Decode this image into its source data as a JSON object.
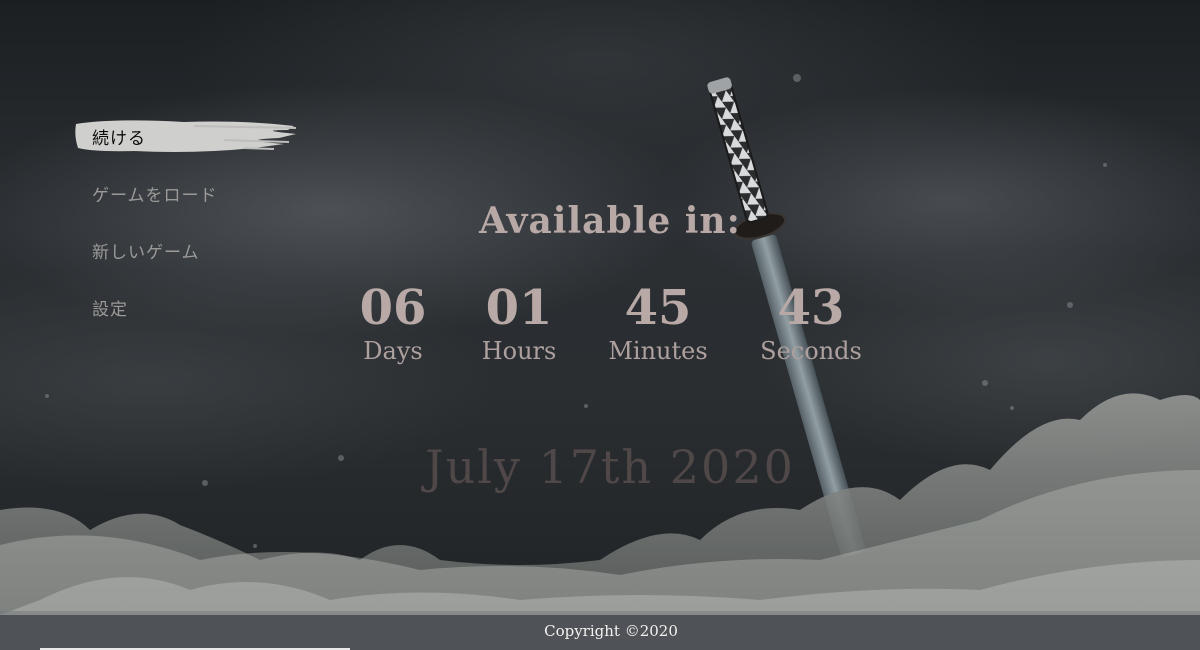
{
  "menu": {
    "items": [
      {
        "label": "続ける",
        "active": true
      },
      {
        "label": "ゲームをロード",
        "active": false
      },
      {
        "label": "新しいゲーム",
        "active": false
      },
      {
        "label": "設定",
        "active": false
      }
    ]
  },
  "countdown": {
    "headline": "Available in:",
    "units": [
      {
        "value": "06",
        "label": "Days"
      },
      {
        "value": "01",
        "label": "Hours"
      },
      {
        "value": "45",
        "label": "Minutes"
      },
      {
        "value": "43",
        "label": "Seconds"
      }
    ],
    "release_date": "July 17th 2020"
  },
  "footer": {
    "copyright": "Copyright ©2020"
  },
  "colors": {
    "text_primary": "#b8a9a6",
    "date_text": "#4f4748",
    "footer_bg": "#767a80",
    "footer_text": "#f4f2ef",
    "brush": "#d8d8d6"
  },
  "icons": {
    "background": "katana-in-grass-illustration",
    "menu_highlight": "brush-stroke-highlight"
  }
}
